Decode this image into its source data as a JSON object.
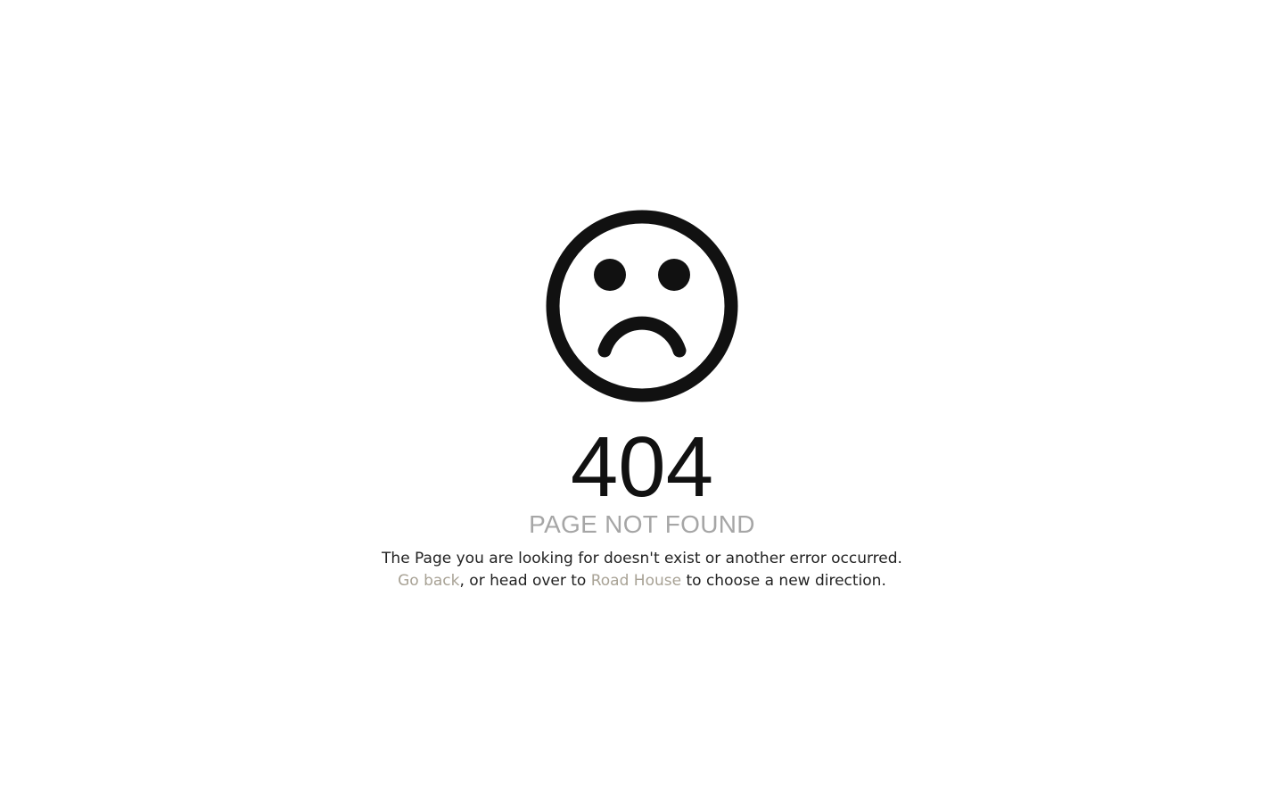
{
  "error": {
    "icon": "sad-face-icon",
    "code": "404",
    "headline": "PAGE NOT FOUND",
    "message": "The Page you are looking for doesn't exist or another error occurred.",
    "nav_prefix_link": "Go back",
    "nav_middle": ", or head over to",
    "nav_home_link": "Road House",
    "nav_suffix": "to choose a new direction."
  },
  "colors": {
    "icon": "#111111",
    "headline": "#a6a6a6",
    "body_text": "#222222",
    "link": "#a8a295",
    "background": "#ffffff"
  }
}
